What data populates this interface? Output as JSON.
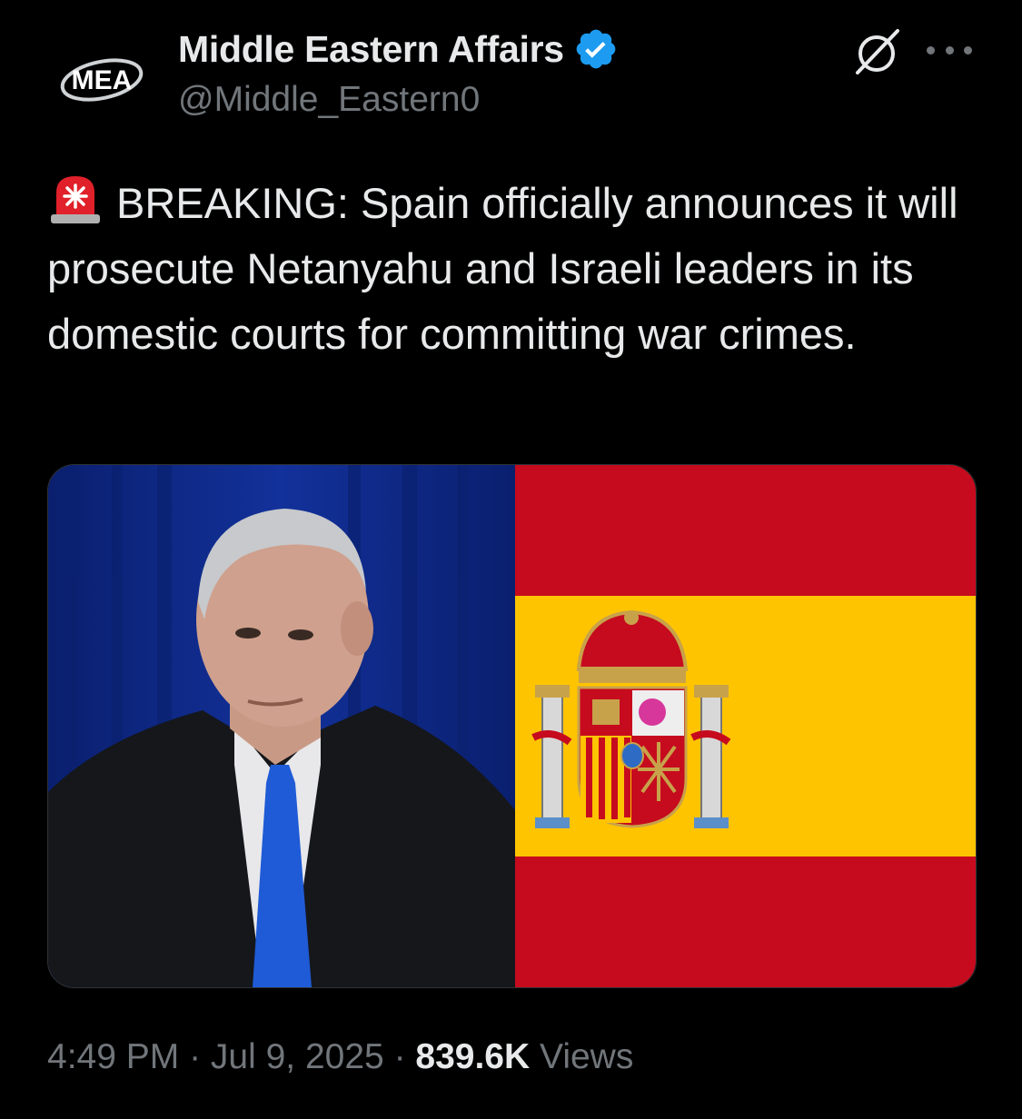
{
  "author": {
    "name": "Middle Eastern Affairs",
    "handle": "@Middle_Eastern0",
    "avatar_text": "MEA",
    "verified_icon": "verified-badge-icon",
    "verified_color": "#1d9bf0"
  },
  "header_icons": {
    "grok": "grok-icon",
    "more": "more-dots-icon"
  },
  "tweet": {
    "emoji": "police-siren-icon",
    "text": "BREAKING: Spain officially announces it will prosecute Netanyahu and Israeli leaders in its domestic courts for committing war crimes."
  },
  "media": {
    "left_image": "man-in-suit-photo",
    "right_image": "spain-flag",
    "flag_colors": {
      "red": "#c60b1e",
      "yellow": "#ffc400"
    }
  },
  "meta": {
    "time": "4:49 PM",
    "separator": " · ",
    "date": "Jul 9, 2025",
    "views_count": "839.6K",
    "views_label": "Views"
  },
  "colors": {
    "background": "#000000",
    "primary_text": "#e7e9ea",
    "secondary_text": "#71767b",
    "accent": "#1d9bf0"
  }
}
